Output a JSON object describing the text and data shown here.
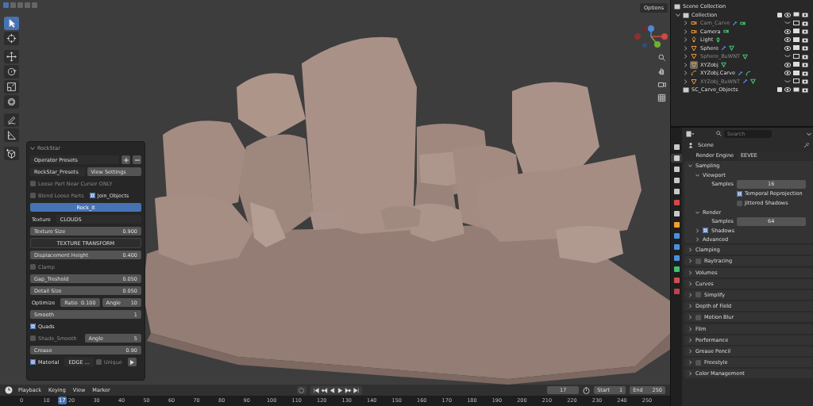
{
  "viewport": {
    "options": "Options",
    "select_modes": [
      {
        "selected": true
      },
      {
        "selected": false
      },
      {
        "selected": false
      },
      {
        "selected": false
      },
      {
        "selected": false
      }
    ],
    "tools": [
      {
        "kind": "select",
        "selected": true
      },
      {
        "kind": "cursor",
        "selected": false
      },
      {
        "kind": "move",
        "selected": false
      },
      {
        "kind": "rotate",
        "selected": false
      },
      {
        "kind": "scale",
        "selected": false
      },
      {
        "kind": "transform",
        "selected": false
      },
      {
        "kind": "annotate",
        "selected": false
      },
      {
        "kind": "measure",
        "selected": false
      },
      {
        "kind": "add-cube",
        "selected": false
      }
    ],
    "nav": [
      {
        "kind": "zoom"
      },
      {
        "kind": "pan"
      },
      {
        "kind": "camera"
      },
      {
        "kind": "grid"
      }
    ]
  },
  "operator_panel": {
    "title": "RockStar",
    "rows": [
      {
        "kind": "presets",
        "label": "Operator Presets"
      },
      {
        "kind": "preset-pair",
        "select": "RockStar_Presets",
        "button": "View Settings"
      },
      {
        "kind": "checks",
        "items": [
          {
            "label": "Loose Part Near Cursor ONLY",
            "checked": false
          }
        ]
      },
      {
        "kind": "checks",
        "items": [
          {
            "label": "Blend Loose Parts",
            "checked": false
          },
          {
            "label": "Join_Objects",
            "checked": true
          }
        ]
      },
      {
        "kind": "action",
        "label": "Rock_it"
      },
      {
        "kind": "select",
        "label": "Texture",
        "value": "CLOUDS"
      },
      {
        "kind": "field",
        "label": "Texture Size",
        "value": "0.900"
      },
      {
        "kind": "subpanel",
        "label": "TEXTURE TRANSFORM"
      },
      {
        "kind": "field",
        "label": "Displacement Height",
        "value": "0.400"
      },
      {
        "kind": "checks",
        "items": [
          {
            "label": "Clamp",
            "checked": false
          }
        ]
      },
      {
        "kind": "field",
        "label": "Gap_Treshold",
        "value": "0.050"
      },
      {
        "kind": "field",
        "label": "Detail Size",
        "value": "0.050"
      },
      {
        "kind": "optimize",
        "label": "Optimize",
        "fields": [
          {
            "label": "Ratio",
            "value": "0.100"
          },
          {
            "label": "Angle",
            "value": "10"
          }
        ]
      },
      {
        "kind": "field",
        "label": "Smooth",
        "value": "1"
      },
      {
        "kind": "checks",
        "items": [
          {
            "label": "Quads",
            "checked": true
          }
        ]
      },
      {
        "kind": "check-field",
        "label": "Shade_Smooth",
        "checked": false,
        "field": {
          "label": "Angle",
          "value": "5"
        }
      },
      {
        "kind": "field",
        "label": "Crease",
        "value": "0.90"
      },
      {
        "kind": "material",
        "label": "Material",
        "checked": true,
        "value": "EDGE ...",
        "unique": {
          "label": "Unique",
          "checked": false
        }
      }
    ]
  },
  "outliner": {
    "root": "Scene Collection",
    "collections": [
      {
        "name": "Collection",
        "checked": true,
        "children": [
          {
            "name": "Cam_Carve",
            "kind": "camera",
            "hidden": true,
            "active": false,
            "modifier": true
          },
          {
            "name": "Camera",
            "kind": "camera",
            "hidden": false,
            "active": false,
            "modifier": false
          },
          {
            "name": "Light",
            "kind": "light",
            "hidden": false,
            "active": false,
            "modifier": false
          },
          {
            "name": "Sphere",
            "kind": "mesh",
            "hidden": false,
            "active": false,
            "modifier": true
          },
          {
            "name": "Sphere_BuWNT",
            "kind": "mesh",
            "hidden": true,
            "active": false,
            "modifier": false
          },
          {
            "name": "XYZobj",
            "kind": "mesh",
            "hidden": false,
            "active": true,
            "modifier": false
          },
          {
            "name": "XYZobj.Carve",
            "kind": "curve",
            "hidden": false,
            "active": false,
            "modifier": true
          },
          {
            "name": "XYZobj_BuWNT",
            "kind": "mesh",
            "hidden": true,
            "active": false,
            "modifier": true
          }
        ]
      },
      {
        "name": "SC_Carve_Objects",
        "checked": true
      }
    ]
  },
  "properties": {
    "search": {
      "placeholder": "Search"
    },
    "tabs": [
      {
        "kind": "tool",
        "selected": false
      },
      {
        "kind": "render",
        "selected": true
      },
      {
        "kind": "output",
        "selected": false
      },
      {
        "kind": "view-layer",
        "selected": false
      },
      {
        "kind": "scene",
        "selected": false
      },
      {
        "kind": "world",
        "selected": false
      },
      {
        "kind": "collection",
        "selected": false
      },
      {
        "kind": "object",
        "selected": false
      },
      {
        "kind": "modifier",
        "selected": false
      },
      {
        "kind": "particles",
        "selected": false
      },
      {
        "kind": "physics",
        "selected": false
      },
      {
        "kind": "data",
        "selected": false
      },
      {
        "kind": "material",
        "selected": false
      },
      {
        "kind": "texture",
        "selected": false
      }
    ],
    "context": "Scene",
    "render_engine": {
      "label": "Render Engine",
      "value": "EEVEE"
    },
    "panels": [
      {
        "label": "Sampling",
        "expanded": true,
        "content": [
          {
            "kind": "subheader",
            "label": "Viewport",
            "expanded": true
          },
          {
            "kind": "field",
            "label": "Samples",
            "value": "16"
          },
          {
            "kind": "check",
            "label": "Temporal Reprojection",
            "checked": true
          },
          {
            "kind": "check",
            "label": "Jittered Shadows",
            "checked": false
          },
          {
            "kind": "subheader",
            "label": "Render",
            "expanded": true
          },
          {
            "kind": "field",
            "label": "Samples",
            "value": "64"
          },
          {
            "kind": "subheader",
            "label": "Shadows",
            "expanded": false,
            "checked": true
          },
          {
            "kind": "subheader",
            "label": "Advanced",
            "expanded": false
          }
        ]
      },
      {
        "label": "Clamping",
        "expanded": false
      },
      {
        "label": "Raytracing",
        "expanded": false,
        "checked": false
      },
      {
        "label": "Volumes",
        "expanded": false
      },
      {
        "label": "Curves",
        "expanded": false
      },
      {
        "label": "Simplify",
        "expanded": false,
        "checked": false
      },
      {
        "label": "Depth of Field",
        "expanded": false
      },
      {
        "label": "Motion Blur",
        "expanded": false,
        "checked": false
      },
      {
        "label": "Film",
        "expanded": false
      },
      {
        "label": "Performance",
        "expanded": false
      },
      {
        "label": "Grease Pencil",
        "expanded": false
      },
      {
        "label": "Freestyle",
        "expanded": false,
        "checked": false
      },
      {
        "label": "Color Management",
        "expanded": false
      }
    ]
  },
  "timeline": {
    "menus": [
      "Playback",
      "Keying",
      "View",
      "Marker"
    ],
    "controls": [
      {
        "kind": "jump-start"
      },
      {
        "kind": "prev-key"
      },
      {
        "kind": "reverse"
      },
      {
        "kind": "play"
      },
      {
        "kind": "next-key"
      },
      {
        "kind": "jump-end"
      }
    ],
    "frame": "17",
    "start": {
      "label": "Start",
      "value": "1"
    },
    "end": {
      "label": "End",
      "value": "250"
    },
    "current_frame": "17",
    "ticks": [
      "0",
      "10",
      "20",
      "30",
      "40",
      "50",
      "60",
      "70",
      "80",
      "90",
      "100",
      "110",
      "120",
      "130",
      "140",
      "150",
      "160",
      "170",
      "180",
      "190",
      "200",
      "210",
      "220",
      "230",
      "240",
      "250"
    ]
  }
}
